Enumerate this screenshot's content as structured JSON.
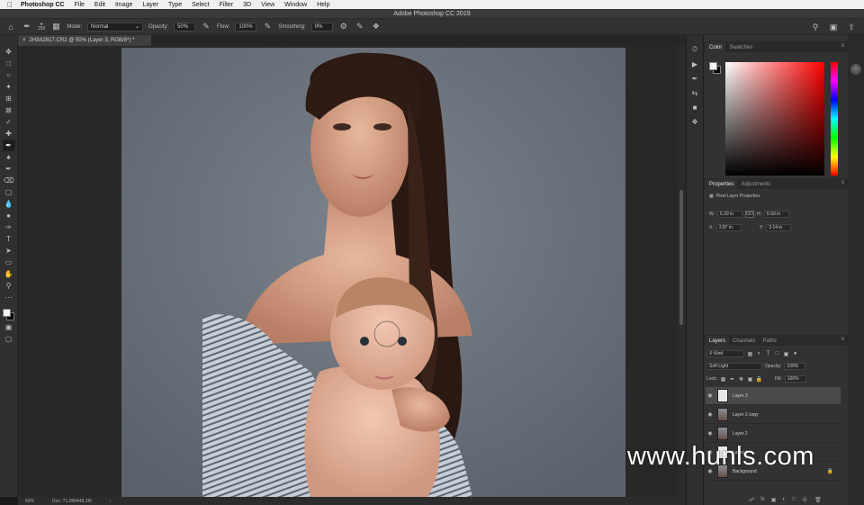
{
  "menubar": {
    "app_name": "Photoshop CC",
    "items": [
      "File",
      "Edit",
      "Image",
      "Layer",
      "Type",
      "Select",
      "Filter",
      "3D",
      "View",
      "Window",
      "Help"
    ]
  },
  "window": {
    "title": "Adobe Photoshop CC 2019"
  },
  "options": {
    "brush_size": "250",
    "mode_label": "Mode:",
    "mode_value": "Normal",
    "opacity_label": "Opacity:",
    "opacity_value": "50%",
    "flow_label": "Flow:",
    "flow_value": "100%",
    "smoothing_label": "Smoothing:",
    "smoothing_value": "0%"
  },
  "document": {
    "tab_title": "2H3A2817.CR2 @ 50% (Layer 3, RGB/8*) *",
    "zoom": "50%",
    "doc_info": "Doc: 71.0M/448.2M"
  },
  "color_panel": {
    "tabs": [
      "Color",
      "Swatches"
    ],
    "active_tab": 0
  },
  "properties_panel": {
    "tabs": [
      "Properties",
      "Adjustments"
    ],
    "header": "Pixel Layer Properties",
    "w_label": "W:",
    "w_value": "5.29 in",
    "h_label": "H:",
    "h_value": "6.69 in",
    "x_label": "X:",
    "x_value": "3.87 in",
    "y_label": "Y:",
    "y_value": "3.14 in",
    "link_label": "GO"
  },
  "layers_panel": {
    "tabs": [
      "Layers",
      "Channels",
      "Paths"
    ],
    "filter_value": "Kind",
    "blend_mode": "Soft Light",
    "opacity_label": "Opacity:",
    "opacity_value": "100%",
    "lock_label": "Lock:",
    "fill_label": "Fill:",
    "fill_value": "100%",
    "layers": [
      {
        "name": "Layer 3",
        "thumb": "white",
        "active": true
      },
      {
        "name": "Layer 2 copy",
        "thumb": "photo",
        "active": false
      },
      {
        "name": "Layer 2",
        "thumb": "photo",
        "active": false
      },
      {
        "name": "Layer 1",
        "thumb": "white",
        "active": false
      },
      {
        "name": "Background",
        "thumb": "photo",
        "active": false,
        "locked": true
      }
    ]
  },
  "watermark": "www.hunls.com",
  "colors": {
    "menubar_bg": "#f0f0f0",
    "panel_bg": "#323232",
    "foreground": "#f2f2f2",
    "background": "#000000"
  }
}
